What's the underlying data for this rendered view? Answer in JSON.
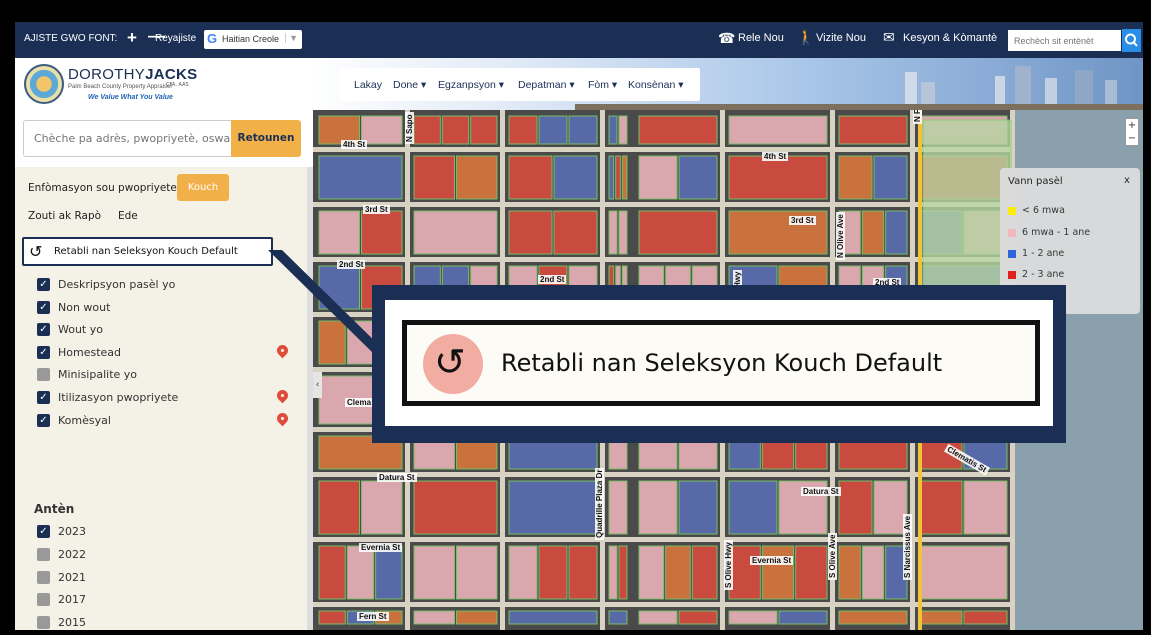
{
  "topbar": {
    "font_label": "AJISTE GWO FONT:",
    "font_plus": "+",
    "font_minus": "—",
    "reset_font": "Reyajiste",
    "translate_g": "G",
    "translate_lang": "Haitian Creole",
    "translate_arrow": "▼",
    "call_label": "Rele Nou",
    "call_icon": "☎",
    "visit_label": "Vizite Nou",
    "visit_icon": "🚶",
    "contact_label": "Kesyon & Kòmantè",
    "contact_icon": "✉",
    "site_search_placeholder": "Rechèch sit entènèt",
    "site_search_icon": "⚲"
  },
  "header": {
    "logo_name_light": "DOROTHY",
    "logo_name_bold": "JACKS",
    "logo_credentials": "CFA, AAS",
    "logo_subtitle": "Palm Beach County Property Appraiser",
    "logo_tagline": "We Value What You Value",
    "nav": [
      {
        "label": "Lakay"
      },
      {
        "label": "Done ▾"
      },
      {
        "label": "Egzanpsyon ▾"
      },
      {
        "label": "Depatman ▾"
      },
      {
        "label": "Fòm ▾"
      },
      {
        "label": "Konsènan ▾"
      }
    ]
  },
  "sidebar": {
    "search_placeholder": "Chèche pa adrès, pwopriyetè, oswa F",
    "search_button": "Retounen",
    "tabs": {
      "info": "Enfòmasyon sou pwopriyete",
      "layers": "Kouch",
      "tools": "Zouti ak Rapò",
      "help": "Ede"
    },
    "reset_label": "Retabli nan Seleksyon Kouch Default",
    "reset_icon": "↺",
    "layers": [
      {
        "label": "Deskripsyon pasèl yo",
        "checked": "✓"
      },
      {
        "label": "Non wout",
        "checked": "✓"
      },
      {
        "label": "Wout yo",
        "checked": "✓"
      },
      {
        "label": "Homestead",
        "checked": "✓"
      },
      {
        "label": "Minisipalite yo",
        "checked": ""
      },
      {
        "label": "Itilizasyon pwopriyete",
        "checked": "✓"
      },
      {
        "label": "Komèsyal",
        "checked": "✓"
      }
    ],
    "antenn_heading": "Antèn",
    "years": [
      {
        "label": "2023",
        "checked": "✓"
      },
      {
        "label": "2022",
        "checked": ""
      },
      {
        "label": "2021",
        "checked": ""
      },
      {
        "label": "2017",
        "checked": ""
      },
      {
        "label": "2015",
        "checked": ""
      }
    ],
    "collapse_icon": "‹"
  },
  "map": {
    "zoom_in": "+",
    "zoom_out": "−",
    "streets": {
      "s1": "4th St",
      "s2": "4th St",
      "s3": "3rd St",
      "s4": "3rd St",
      "s5": "2nd St",
      "s6": "2nd St",
      "s7": "2nd St",
      "s8": "Datura St",
      "s9": "Datura St",
      "s10": "Evernia St",
      "s11": "Evernia St",
      "s12": "Fern St",
      "s13": "Clematis St",
      "s14": "Clema",
      "v1": "N Sapo",
      "v2": "N Olive Ave",
      "v3": "Hwy",
      "v4": "N Fl",
      "v5": "Quadrille Plaza Dr",
      "v6": "S Olive Hwy",
      "v7": "S Olive Ave",
      "v8": "S Narcissus Ave"
    },
    "legend": {
      "title": "Vann pasèl",
      "close": "x",
      "items": [
        {
          "label": "< 6 mwa",
          "color": "#ffee00"
        },
        {
          "label": "6 mwa - 1 ane",
          "color": "#f4b8c0"
        },
        {
          "label": "1 - 2 ane",
          "color": "#2b62d9"
        },
        {
          "label": "2 - 3 ane",
          "color": "#e01a1a"
        }
      ]
    }
  },
  "callout": {
    "icon": "↺",
    "text": "Retabli nan Seleksyon Kouch Default"
  },
  "colors": {
    "navy": "#1b2f55",
    "accent_orange": "#f2b048",
    "sidebar_bg": "#f4f1e7",
    "parcel_pink": "#f4b8c0",
    "parcel_red": "#e04b3c",
    "parcel_blue": "#5a6fb8",
    "parcel_orange": "#e0793c"
  }
}
